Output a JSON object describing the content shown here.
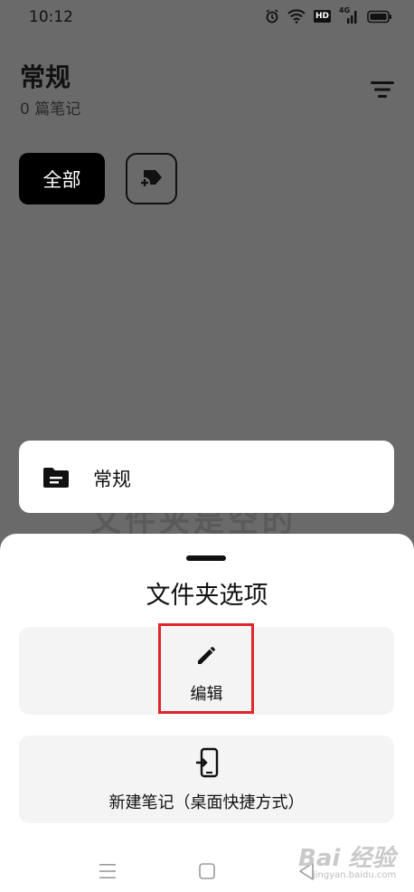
{
  "status_bar": {
    "time": "10:12",
    "icons": [
      "alarm-icon",
      "wifi-icon",
      "hd-icon",
      "4g-signal-icon",
      "battery-icon"
    ],
    "hd_label": "HD",
    "net_label": "4G"
  },
  "header": {
    "title": "常规",
    "subtitle": "0 篇笔记"
  },
  "chips": {
    "all_label": "全部"
  },
  "background": {
    "ghost_text": "文件夹是空的"
  },
  "folder_card": {
    "name": "常规"
  },
  "sheet": {
    "title": "文件夹选项",
    "options": [
      {
        "label": "编辑",
        "icon": "pencil-icon"
      },
      {
        "label": "新建笔记（桌面快捷方式）",
        "icon": "add-to-home-icon"
      }
    ]
  },
  "watermark": {
    "text": "Bai 经验",
    "sub": "jingyan.baidu.com"
  },
  "colors": {
    "overlay": "#6a6a6a",
    "highlight": "#e0262a",
    "card": "#f4f4f4"
  }
}
